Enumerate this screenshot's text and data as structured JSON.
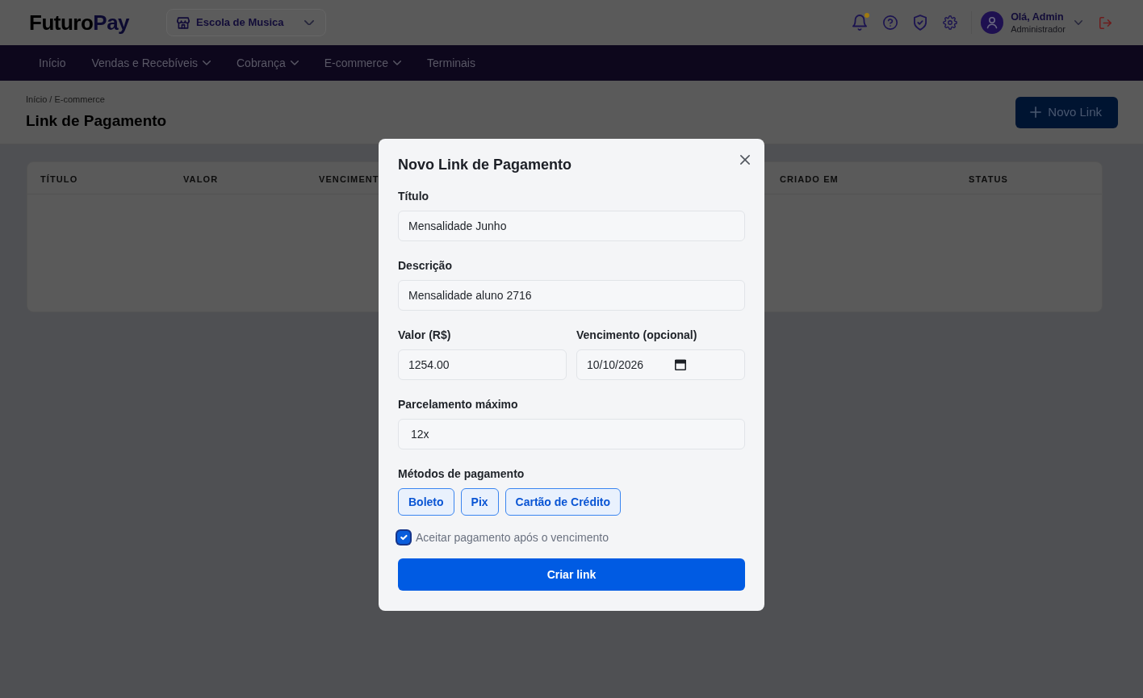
{
  "header": {
    "logo": {
      "parts": [
        "Futuro",
        "Pay"
      ]
    },
    "store_selector": {
      "value": "Escola de Musica"
    },
    "notifications": {
      "unread": true
    },
    "user": {
      "greeting": "Olá, Admin",
      "role": "Administrador"
    }
  },
  "nav": {
    "items": [
      {
        "label": "Início",
        "dropdown": false
      },
      {
        "label": "Vendas e Recebíveis",
        "dropdown": true
      },
      {
        "label": "Cobrança",
        "dropdown": true
      },
      {
        "label": "E-commerce",
        "dropdown": true
      },
      {
        "label": "Terminais",
        "dropdown": false
      }
    ]
  },
  "page": {
    "breadcrumb": "Início / E-commerce",
    "title": "Link de Pagamento",
    "new_button": "Novo Link"
  },
  "table": {
    "columns": [
      "TÍTULO",
      "VALOR",
      "VENCIMENT",
      "CRIADO EM",
      "STATUS"
    ]
  },
  "modal": {
    "title": "Novo Link de Pagamento",
    "rows": [
      [
        {
          "kind": "text",
          "label": "Título",
          "value": "Mensalidade Junho"
        }
      ],
      [
        {
          "kind": "text",
          "label": "Descrição",
          "value": "Mensalidade aluno 2716"
        }
      ],
      [
        {
          "kind": "text",
          "label": "Valor (R$)",
          "value": "1254.00"
        },
        {
          "kind": "date",
          "label": "Vencimento (opcional)",
          "value": "10/10/2026"
        }
      ],
      [
        {
          "kind": "select",
          "label": "Parcelamento máximo",
          "value": "12x"
        }
      ]
    ],
    "payment_methods": {
      "label": "Métodos de pagamento",
      "options": [
        {
          "label": "Boleto",
          "selected": true
        },
        {
          "label": "Pix",
          "selected": true
        },
        {
          "label": "Cartão de Crédito",
          "selected": true
        }
      ]
    },
    "late_payment": {
      "label": "Aceitar pagamento após o vencimento",
      "checked": true
    },
    "submit": "Criar link"
  }
}
